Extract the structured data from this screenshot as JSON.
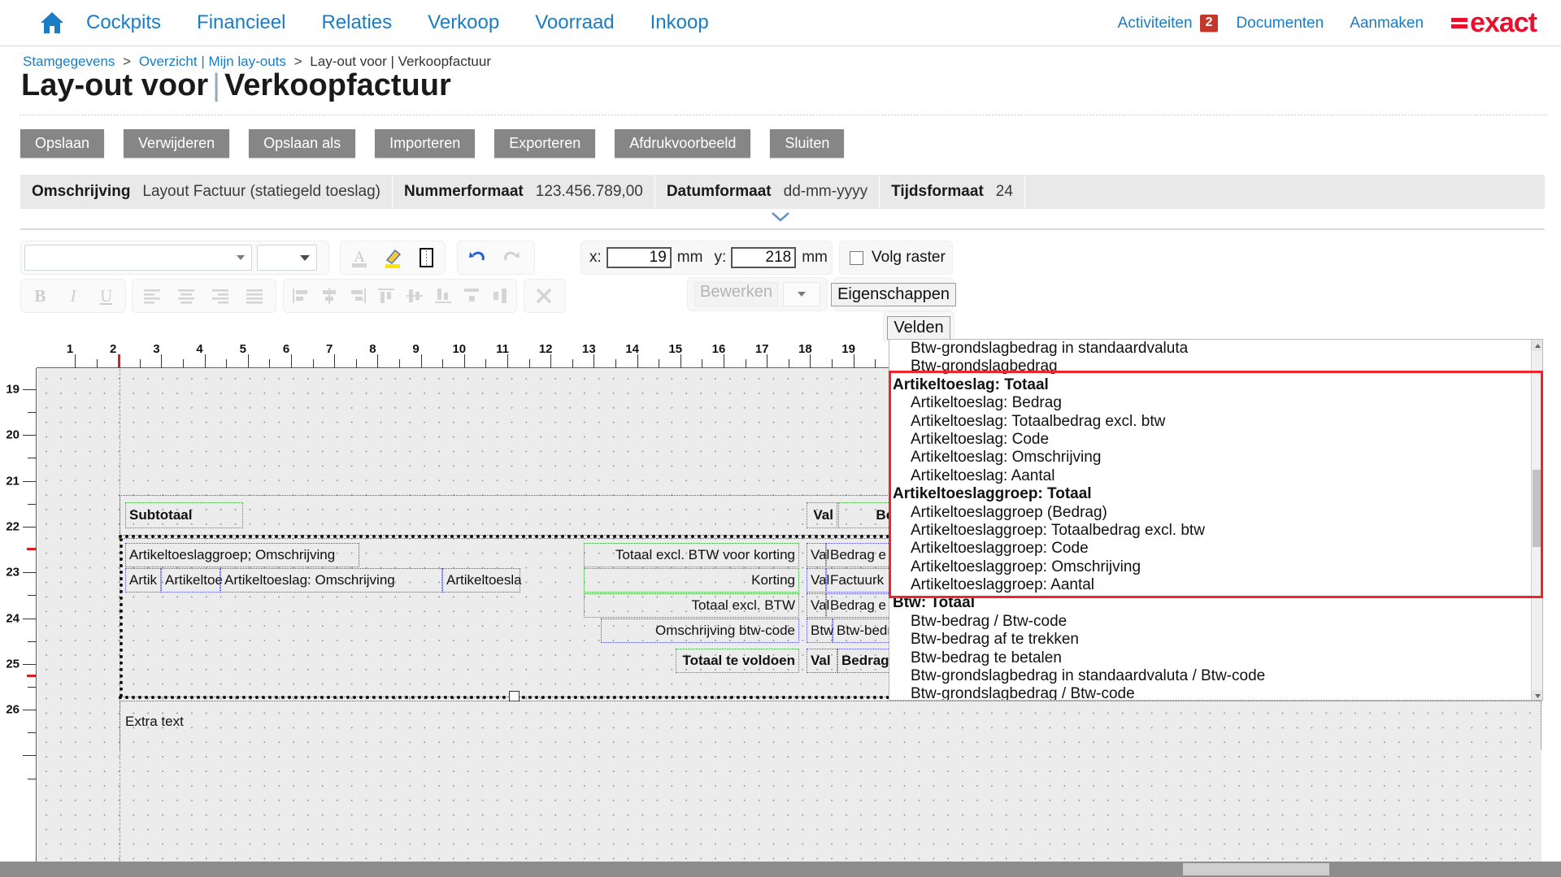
{
  "topnav": {
    "home_icon": "home-icon",
    "items": [
      "Cockpits",
      "Financieel",
      "Relaties",
      "Verkoop",
      "Voorraad",
      "Inkoop"
    ],
    "right_items": [
      "Activiteiten",
      "Documenten",
      "Aanmaken"
    ],
    "activiteiten_label": "Activiteiten",
    "activiteiten_badge": "2",
    "documenten_label": "Documenten",
    "aanmaken_label": "Aanmaken",
    "logo_text": "exact",
    "logo_color": "#e8112d"
  },
  "breadcrumb": {
    "items": [
      "Stamgegevens",
      "Overzicht | Mijn lay-outs",
      "Lay-out voor | Verkoopfactuur"
    ],
    "separator": ">"
  },
  "title": {
    "prefix": "Lay-out voor",
    "sep": "|",
    "suffix": "Verkoopfactuur"
  },
  "buttons": [
    "Opslaan",
    "Verwijderen",
    "Opslaan als",
    "Importeren",
    "Exporteren",
    "Afdrukvoorbeeld",
    "Sluiten"
  ],
  "infobar": [
    {
      "key": "Omschrijving",
      "value": "Layout Factuur (statiegeld toeslag)"
    },
    {
      "key": "Nummerformaat",
      "value": "123.456.789,00"
    },
    {
      "key": "Datumformaat",
      "value": "dd-mm-yyyy"
    },
    {
      "key": "Tijdsformaat",
      "value": "24"
    }
  ],
  "toolbar": {
    "font_select_value": "",
    "size_select_value": "",
    "icons_row1": [
      "font-color-icon",
      "highlight-icon",
      "border-icon",
      "undo-icon",
      "redo-icon"
    ],
    "icons_row2": [
      "bold-icon",
      "italic-icon",
      "underline-icon",
      "align-left-icon",
      "align-center-icon",
      "align-right-icon",
      "align-justify-icon",
      "align-objects-left-icon",
      "align-objects-center-icon",
      "align-objects-right-icon",
      "align-objects-top-icon",
      "align-objects-middle-icon",
      "align-objects-bottom-icon",
      "distribute-horizontal-icon",
      "distribute-vertical-icon",
      "delete-icon"
    ],
    "x_label": "x:",
    "x_value": "19",
    "x_unit": "mm",
    "y_label": "y:",
    "y_value": "218",
    "y_unit": "mm",
    "raster_label": "Volg raster",
    "raster_checked": false,
    "bewerken_label": "Bewerken",
    "bewerken_select_value": "",
    "eigenschappen_label": "Eigenschappen",
    "velden_label": "Velden"
  },
  "ruler": {
    "h_numbers": [
      "1",
      "2",
      "3",
      "4",
      "5",
      "6",
      "7",
      "8",
      "9",
      "10",
      "11",
      "12",
      "13",
      "14",
      "15",
      "16",
      "17",
      "18",
      "19"
    ],
    "v_numbers": [
      "19",
      "20",
      "21",
      "22",
      "23",
      "24",
      "25",
      "26"
    ],
    "unit": "cm"
  },
  "canvas": {
    "labels": [
      {
        "text": "Subtotaal",
        "bold": true
      },
      {
        "text": "Val",
        "bold": true
      },
      {
        "text": "Bedrag",
        "bold": true
      },
      {
        "text": "Artikeltoeslaggroep; Omschrijving",
        "bold": false
      },
      {
        "text": "Totaal excl. BTW voor korting",
        "bold": false
      },
      {
        "text": "Val",
        "bold": false
      },
      {
        "text": "Bedrag e",
        "bold": false
      },
      {
        "text": "Artik",
        "bold": false
      },
      {
        "text": "Artikeltoe",
        "bold": false
      },
      {
        "text": "Artikeltoeslag: Omschrijving",
        "bold": false
      },
      {
        "text": "Artikeltoesla",
        "bold": false
      },
      {
        "text": "Korting",
        "bold": false
      },
      {
        "text": "Val",
        "bold": false
      },
      {
        "text": "Factuurk",
        "bold": false
      },
      {
        "text": "Totaal excl. BTW",
        "bold": false
      },
      {
        "text": "Val",
        "bold": false
      },
      {
        "text": "Bedrag e",
        "bold": false
      },
      {
        "text": "Omschrijving btw-code",
        "bold": false
      },
      {
        "text": "Btw",
        "bold": false
      },
      {
        "text": "Btw-bedr",
        "bold": false
      },
      {
        "text": "Totaal te voldoen",
        "bold": true
      },
      {
        "text": "Val",
        "bold": true
      },
      {
        "text": "Bedrag i",
        "bold": true
      },
      {
        "text": "Extra text",
        "bold": false
      }
    ]
  },
  "fields_panel": {
    "items": [
      {
        "label": "Btw-grondslagbedrag in standaardvaluta",
        "group": false
      },
      {
        "label": "Btw-grondslagbedrag",
        "group": false
      },
      {
        "label": "Artikeltoeslag: Totaal",
        "group": true
      },
      {
        "label": "Artikeltoeslag: Bedrag",
        "group": false
      },
      {
        "label": "Artikeltoeslag: Totaalbedrag excl. btw",
        "group": false
      },
      {
        "label": "Artikeltoeslag: Code",
        "group": false
      },
      {
        "label": "Artikeltoeslag: Omschrijving",
        "group": false
      },
      {
        "label": "Artikeltoeslag: Aantal",
        "group": false
      },
      {
        "label": "Artikeltoeslaggroep: Totaal",
        "group": true
      },
      {
        "label": "Artikeltoeslaggroep (Bedrag)",
        "group": false
      },
      {
        "label": "Artikeltoeslaggroep: Totaalbedrag excl. btw",
        "group": false
      },
      {
        "label": "Artikeltoeslaggroep: Code",
        "group": false
      },
      {
        "label": "Artikeltoeslaggroep: Omschrijving",
        "group": false
      },
      {
        "label": "Artikeltoeslaggroep: Aantal",
        "group": false
      },
      {
        "label": "Btw: Totaal",
        "group": true
      },
      {
        "label": "Btw-bedrag / Btw-code",
        "group": false
      },
      {
        "label": "Btw-bedrag af te trekken",
        "group": false
      },
      {
        "label": "Btw-bedrag te betalen",
        "group": false
      },
      {
        "label": "Btw-grondslagbedrag in standaardvaluta / Btw-code",
        "group": false
      },
      {
        "label": "Btw-grondslagbedrag / Btw-code",
        "group": false
      }
    ],
    "highlight_color": "#f0252a"
  }
}
